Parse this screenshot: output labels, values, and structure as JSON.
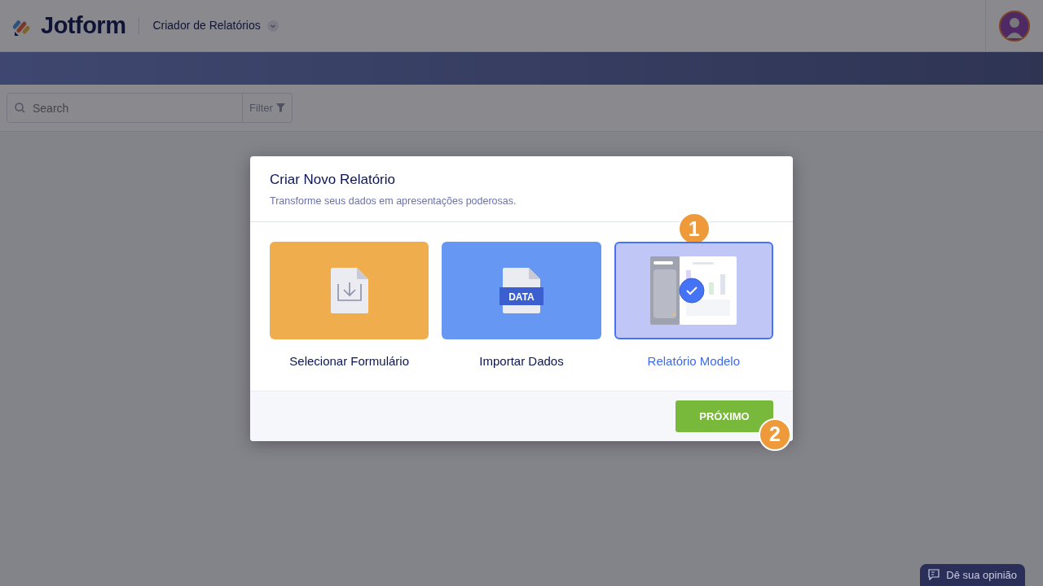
{
  "header": {
    "brand": "Jotform",
    "app_title": "Criador de Relatórios"
  },
  "toolbar": {
    "search": {
      "placeholder": "Search"
    },
    "filter": "Filter"
  },
  "modal": {
    "title": "Criar Novo Relatório",
    "subtitle": "Transforme seus dados em apresentações poderosas.",
    "options": [
      {
        "kind": "form",
        "label": "Selecionar Formulário",
        "color": "#f0ad4e",
        "selected": false
      },
      {
        "kind": "data",
        "label": "Importar Dados",
        "badge": "DATA",
        "color": "#6697f2",
        "selected": false
      },
      {
        "kind": "template",
        "label": "Relatório Modelo",
        "color": "#c0c6f5",
        "selected": true,
        "step": "1"
      }
    ],
    "next_button": {
      "label": "PRÓXIMO",
      "step": "2"
    }
  },
  "feedback_button": "Dê sua opinião"
}
